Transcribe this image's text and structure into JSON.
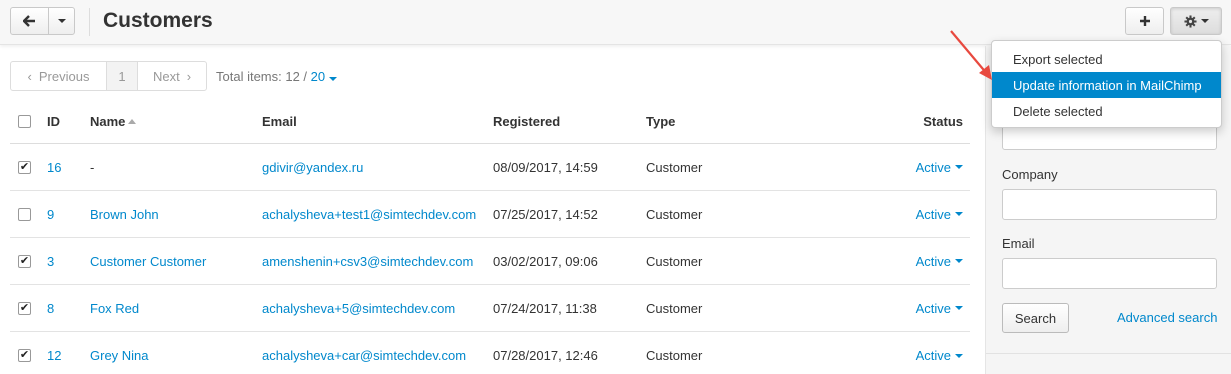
{
  "header": {
    "title": "Customers",
    "back_icon": "arrow-left-icon",
    "add_icon": "plus-icon",
    "settings_icon": "gear-icon"
  },
  "pagination": {
    "previous_label": "Previous",
    "current_page": "1",
    "next_label": "Next",
    "total_label": "Total items: 12 /",
    "per_page": "20"
  },
  "table": {
    "headers": {
      "id": "ID",
      "name": "Name",
      "email": "Email",
      "registered": "Registered",
      "type": "Type",
      "status": "Status"
    },
    "rows": [
      {
        "checked": true,
        "id": "16",
        "name": "-",
        "email": "gdivir@yandex.ru",
        "registered": "08/09/2017, 14:59",
        "type": "Customer",
        "status": "Active"
      },
      {
        "checked": false,
        "id": "9",
        "name": "Brown John",
        "email": "achalysheva+test1@simtechdev.com",
        "registered": "07/25/2017, 14:52",
        "type": "Customer",
        "status": "Active"
      },
      {
        "checked": true,
        "id": "3",
        "name": "Customer Customer",
        "email": "amenshenin+csv3@simtechdev.com",
        "registered": "03/02/2017, 09:06",
        "type": "Customer",
        "status": "Active"
      },
      {
        "checked": true,
        "id": "8",
        "name": "Fox Red",
        "email": "achalysheva+5@simtechdev.com",
        "registered": "07/24/2017, 11:38",
        "type": "Customer",
        "status": "Active"
      },
      {
        "checked": true,
        "id": "12",
        "name": "Grey Nina",
        "email": "achalysheva+car@simtechdev.com",
        "registered": "07/28/2017, 12:46",
        "type": "Customer",
        "status": "Active"
      }
    ]
  },
  "dropdown": {
    "items": [
      "Export selected",
      "Update information in MailChimp",
      "Delete selected"
    ],
    "highlighted_index": 1
  },
  "sidebar": {
    "company_label": "Company",
    "email_label": "Email",
    "search_button": "Search",
    "advanced_link": "Advanced search"
  },
  "colors": {
    "accent": "#0088cc",
    "annotation_arrow": "#e8493f"
  }
}
